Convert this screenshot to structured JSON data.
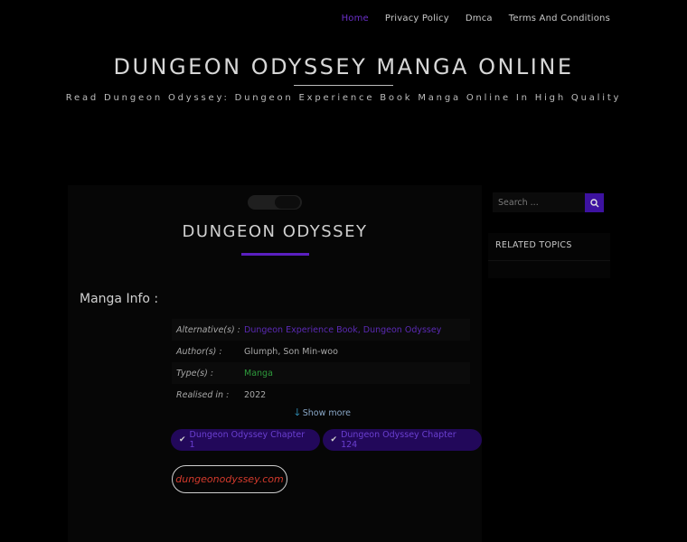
{
  "nav": {
    "items": [
      {
        "label": "Home",
        "active": true
      },
      {
        "label": "Privacy Policy",
        "active": false
      },
      {
        "label": "Dmca",
        "active": false
      },
      {
        "label": "Terms And Conditions",
        "active": false
      }
    ]
  },
  "header": {
    "title": "DUNGEON ODYSSEY MANGA ONLINE",
    "tagline": "Read Dungeon Odyssey: Dungeon Experience Book Manga Online In High Quality"
  },
  "main": {
    "title": "DUNGEON ODYSSEY",
    "info_heading": "Manga Info :",
    "info": [
      {
        "label": "Alternative(s) :",
        "value": "Dungeon Experience Book, Dungeon Odyssey",
        "style": "link"
      },
      {
        "label": "Author(s) :",
        "value": "Glumph, Son Min-woo",
        "style": "plain"
      },
      {
        "label": "Type(s) :",
        "value": "Manga",
        "style": "green"
      },
      {
        "label": "Realised in :",
        "value": "2022",
        "style": "plain"
      }
    ],
    "show_more": "Show more",
    "chapters": [
      {
        "label": "Dungeon Odyssey Chapter 1"
      },
      {
        "label": "Dungeon Odyssey Chapter 124"
      }
    ],
    "domain_button": "dungeonodyssey.com"
  },
  "sidebar": {
    "search_placeholder": "Search ...",
    "related_title": "RELATED TOPICS"
  },
  "colors": {
    "accent": "#5a1fc0",
    "active_nav": "#6a2fc8",
    "domain_text": "#d33a2c"
  }
}
